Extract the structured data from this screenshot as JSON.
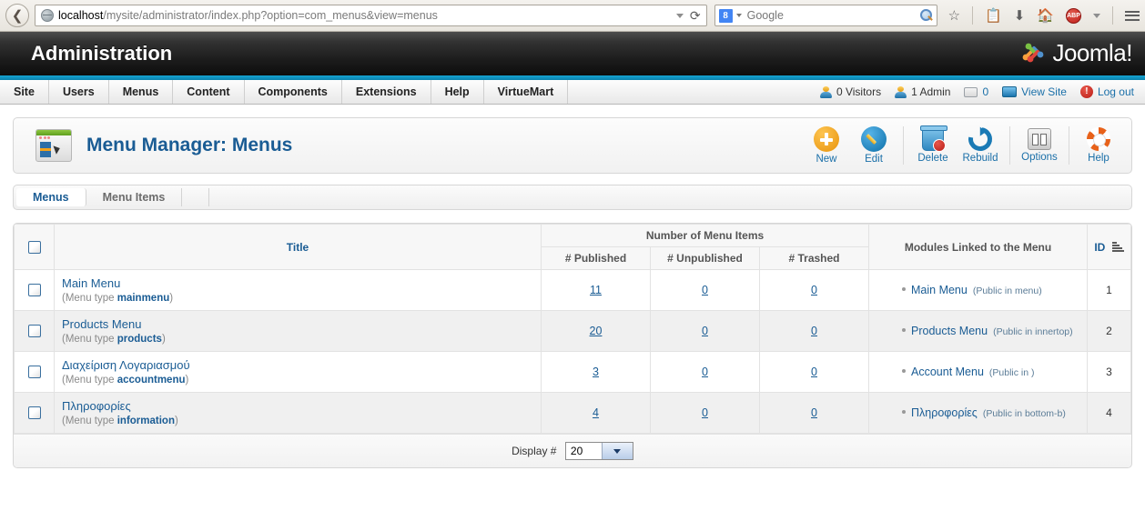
{
  "browser": {
    "back_icon": "back-arrow-icon",
    "url_prefix": "localhost",
    "url_rest": "/mysite/administrator/index.php?option=com_menus&view=menus",
    "url_full": "localhost/mysite/administrator/index.php?option=com_menus&view=menus",
    "reload_glyph": "⟳",
    "search_engine_badge": "8",
    "search_placeholder": "Google",
    "icons": [
      "bookmark-star-icon",
      "reading-list-icon",
      "downloads-icon",
      "home-icon",
      "adblock-plus-icon",
      "menu-hamburger-icon"
    ],
    "adblock_label": "ABP"
  },
  "header": {
    "title": "Administration",
    "logo_text": "Joomla!",
    "accent_color": "#0c82ac"
  },
  "mainmenu": {
    "items": [
      {
        "label": "Site"
      },
      {
        "label": "Users"
      },
      {
        "label": "Menus"
      },
      {
        "label": "Content"
      },
      {
        "label": "Components"
      },
      {
        "label": "Extensions"
      },
      {
        "label": "Help"
      },
      {
        "label": "VirtueMart"
      }
    ]
  },
  "status": {
    "visitors": "0 Visitors",
    "admins": "1 Admin",
    "messages": "0",
    "view_site": "View Site",
    "logout": "Log out"
  },
  "page": {
    "title": "Menu Manager: Menus",
    "icon": "menu-manager-icon"
  },
  "toolbar": {
    "buttons": [
      {
        "label": "New",
        "icon": "plus-circle-icon"
      },
      {
        "label": "Edit",
        "icon": "pencil-circle-icon"
      },
      {
        "label": "Delete",
        "icon": "trash-can-icon"
      },
      {
        "label": "Rebuild",
        "icon": "refresh-circle-icon"
      },
      {
        "label": "Options",
        "icon": "sliders-icon"
      },
      {
        "label": "Help",
        "icon": "life-ring-icon"
      }
    ]
  },
  "tabs": [
    {
      "label": "Menus",
      "active": true
    },
    {
      "label": "Menu Items",
      "active": false
    }
  ],
  "table": {
    "headers": {
      "title": "Title",
      "group_menu_items": "Number of Menu Items",
      "published": "# Published",
      "unpublished": "# Unpublished",
      "trashed": "# Trashed",
      "modules": "Modules Linked to the Menu",
      "id": "ID"
    },
    "menu_type_prefix": "(Menu type ",
    "menu_type_suffix": ")",
    "rows": [
      {
        "title": "Main Menu",
        "menu_type": "mainmenu",
        "published": "11",
        "unpublished": "0",
        "trashed": "0",
        "module_name": "Main Menu",
        "module_meta": "(Public in menu)",
        "id": "1"
      },
      {
        "title": "Products Menu",
        "menu_type": "products",
        "published": "20",
        "unpublished": "0",
        "trashed": "0",
        "module_name": "Products Menu",
        "module_meta": "(Public in innertop)",
        "id": "2"
      },
      {
        "title": "Διαχείριση Λογαριασμού",
        "menu_type": "accountmenu",
        "published": "3",
        "unpublished": "0",
        "trashed": "0",
        "module_name": "Account Menu",
        "module_meta": "(Public in )",
        "id": "3"
      },
      {
        "title": "Πληροφορίες",
        "menu_type": "information",
        "published": "4",
        "unpublished": "0",
        "trashed": "0",
        "module_name": "Πληροφορίες",
        "module_meta": "(Public in bottom-b)",
        "id": "4"
      }
    ]
  },
  "footer": {
    "display_label": "Display #",
    "display_value": "20"
  }
}
